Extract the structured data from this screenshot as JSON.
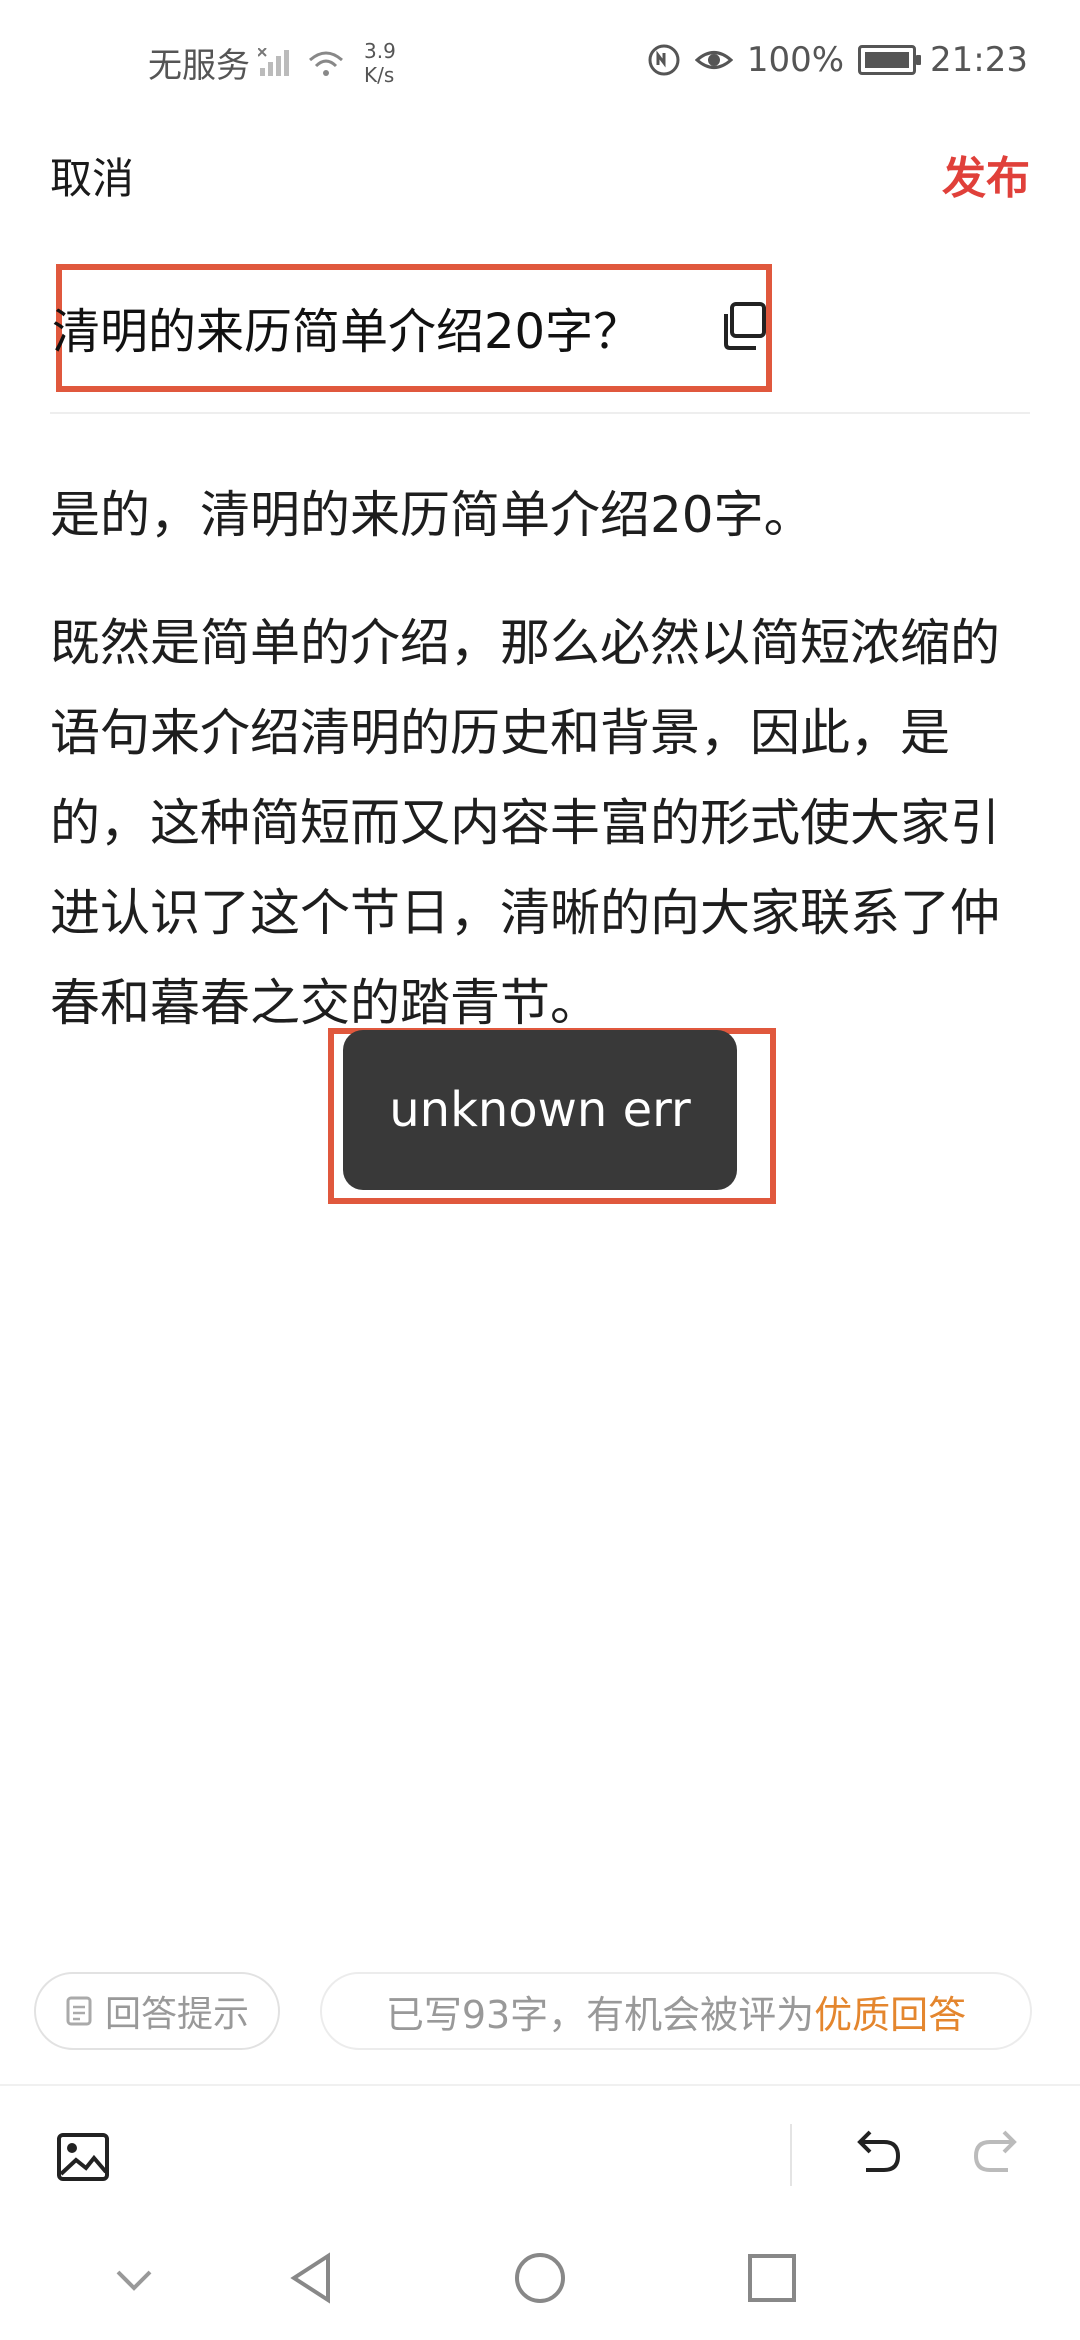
{
  "status_bar": {
    "carrier": "无服务",
    "speed_value": "3.9",
    "speed_unit": "K/s",
    "battery": "100%",
    "time": "21:23"
  },
  "header": {
    "cancel_label": "取消",
    "publish_label": "发布"
  },
  "question": {
    "title": "清明的来历简单介绍20字？"
  },
  "answer": {
    "paragraph_1": "是的，清明的来历简单介绍20字。",
    "paragraph_2": "既然是简单的介绍，那么必然以简短浓缩的语句来介绍清明的历史和背景，因此，是的，这种简短而又内容丰富的形式使大家引进认识了这个节日，清晰的向大家联系了仲春和暮春之交的踏青节。"
  },
  "toast": {
    "message": "unknown err"
  },
  "hint": {
    "chip_label": "回答提示",
    "status_prefix": "已写93字，有机会被评为",
    "status_highlight": "优质回答"
  },
  "colors": {
    "accent_red": "#e0403a",
    "highlight_orange": "#e4862e",
    "annotation_box": "#e0583d",
    "toast_bg": "#393939"
  },
  "icons": [
    "signal-icon",
    "wifi-icon",
    "nfc-icon",
    "eye-icon",
    "battery-icon",
    "copy-icon",
    "hint-doc-icon",
    "image-icon",
    "undo-icon",
    "redo-icon",
    "nav-back-icon",
    "nav-home-icon",
    "nav-recent-icon",
    "nav-collapse-icon"
  ]
}
